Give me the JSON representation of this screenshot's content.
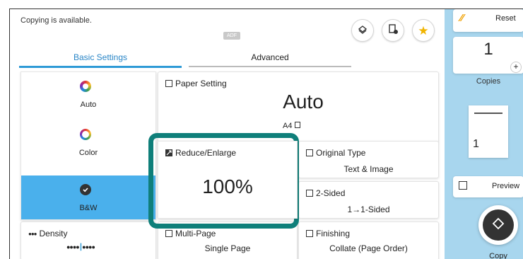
{
  "status": {
    "message": "Copying is available.",
    "adf_label": "ADF"
  },
  "header_icons": [
    "document-feeder-icon",
    "card-check-icon",
    "favorite-star-icon"
  ],
  "tabs": [
    {
      "label": "Basic Settings",
      "active": true
    },
    {
      "label": "Advanced",
      "active": false
    }
  ],
  "color_modes": [
    {
      "label": "Auto",
      "selected": false
    },
    {
      "label": "Color",
      "selected": false
    },
    {
      "label": "B&W",
      "selected": true
    }
  ],
  "density": {
    "label": "Density",
    "level_fraction": 0.5
  },
  "paper_setting": {
    "title": "Paper Setting",
    "value": "Auto",
    "size": "A4"
  },
  "reduce_enlarge": {
    "title": "Reduce/Enlarge",
    "value": "100%"
  },
  "original_type": {
    "title": "Original Type",
    "value": "Text & Image"
  },
  "two_sided": {
    "title": "2-Sided",
    "value": "1→1-Sided"
  },
  "multi_page": {
    "title": "Multi-Page",
    "value": "Single Page"
  },
  "finishing": {
    "title": "Finishing",
    "value": "Collate (Page Order)"
  },
  "sidebar": {
    "reset_label": "Reset",
    "copies_value": "1",
    "copies_label": "Copies",
    "preview_label": "Preview",
    "start_label": "Copy"
  },
  "colors": {
    "accent_blue": "#2e9ad6",
    "selected_bg": "#4ab0ec",
    "highlight_teal": "#0f7f7a",
    "sidebar_bg": "#a8d6ee"
  }
}
